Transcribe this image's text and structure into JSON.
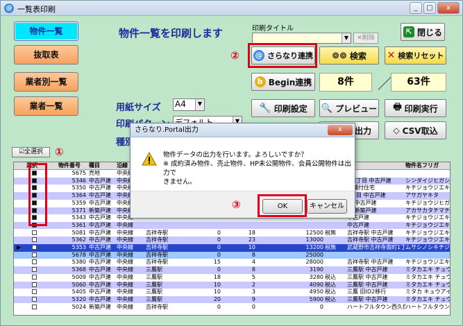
{
  "window": {
    "title": "一覧表印刷",
    "min": "_",
    "max": "□",
    "close": "x"
  },
  "nav": {
    "list": "物件一覧",
    "extract": "抜取表",
    "by_dealer": "業者別一覧",
    "dealer_list": "業者一覧"
  },
  "heading": "物件一覧を印刷します",
  "print_title": {
    "label": "印刷タイトル",
    "value": "",
    "delete_label": "削除"
  },
  "toolbar": {
    "close": "閉じる",
    "sarana": "さらなり連携",
    "search": "検索",
    "search_reset": "検索リセット",
    "begin": "Begin連携",
    "print_settings": "印刷設定",
    "preview": "プレビュー",
    "print_run": "印刷実行",
    "output": "出力",
    "csv_import": "CSV取込"
  },
  "counts": {
    "selected": "8件",
    "total": "63件",
    "slash": "／"
  },
  "paper": {
    "label": "用紙サイズ",
    "value": "A4"
  },
  "pattern": {
    "label": "印刷パターン",
    "value": "デフォルト"
  },
  "kind": {
    "label": "種別"
  },
  "select_all": "全選択",
  "markers": {
    "m1": "①",
    "m2": "②",
    "m3": "③"
  },
  "grid": {
    "headers": [
      "選択",
      "物件番号",
      "種目",
      "沿線",
      "",
      "",
      "",
      "",
      "",
      "",
      "",
      "物件名フリガ"
    ],
    "rows": [
      {
        "checked": true,
        "no": "5675",
        "type": "売地",
        "line": "中央線",
        "station": "",
        "a": "",
        "b": "",
        "price": "",
        "note": "",
        "addr": "",
        "kana": "",
        "style": ""
      },
      {
        "checked": true,
        "no": "5346",
        "type": "中古戸建",
        "line": "中央線",
        "station": "",
        "a": "",
        "b": "",
        "price": "",
        "note": "",
        "addr": "町3丁目 中古戸建",
        "kana": "シンダイジヒガシ",
        "style": "alt"
      },
      {
        "checked": true,
        "no": "5350",
        "type": "中古戸建",
        "line": "中央線",
        "station": "",
        "a": "",
        "b": "",
        "price": "",
        "note": "",
        "addr": "店舗付住宅",
        "kana": "キチジョウジエキ",
        "style": ""
      },
      {
        "checked": true,
        "no": "5364",
        "type": "中古戸建",
        "line": "中央線",
        "station": "",
        "a": "",
        "b": "",
        "price": "",
        "note": "",
        "addr": "3丁目 中古戸建",
        "kana": "アサガヤキタ",
        "style": "alt"
      },
      {
        "checked": true,
        "no": "5359",
        "type": "中古戸建",
        "line": "中央線",
        "station": "",
        "a": "",
        "b": "",
        "price": "",
        "note": "",
        "addr": "町 中古戸建",
        "kana": "キチジョウジヒガシ",
        "style": ""
      },
      {
        "checked": true,
        "no": "5371",
        "type": "新築戸建",
        "line": "中央線",
        "station": "",
        "a": "",
        "b": "",
        "price": "",
        "note": "",
        "addr": "中 新築戸建",
        "kana": "アカサカタチマチ",
        "style": "alt"
      },
      {
        "checked": true,
        "no": "5343",
        "type": "中古戸建",
        "line": "中央線",
        "station": "",
        "a": "",
        "b": "",
        "price": "",
        "note": "",
        "addr": "中古戸建",
        "kana": "キチジョウジエキ",
        "style": ""
      },
      {
        "checked": true,
        "no": "5361",
        "type": "中古戸建",
        "line": "中央線",
        "station": "",
        "a": "",
        "b": "",
        "price": "",
        "note": "",
        "addr": "中古戸建",
        "kana": "キチジョウジエキ",
        "style": "alt"
      },
      {
        "checked": false,
        "no": "5081",
        "type": "中古戸建",
        "line": "中央線",
        "station": "吉祥寺駅",
        "a": "0",
        "b": "18",
        "price": "12500",
        "note": "税無",
        "addr": "吉祥寺駅 中古戸建",
        "kana": "キチジョウジエキ",
        "style": ""
      },
      {
        "checked": false,
        "no": "5362",
        "type": "中古戸建",
        "line": "中央線",
        "station": "吉祥寺駅",
        "a": "0",
        "b": "23",
        "price": "13000",
        "note": "",
        "addr": "吉祥寺駅 中古戸建",
        "kana": "キチジョウジエキ",
        "style": "alt"
      },
      {
        "checked": false,
        "no": "5353",
        "type": "中古戸建",
        "line": "中央線",
        "station": "吉祥寺駅",
        "a": "0",
        "b": "10",
        "price": "13200",
        "note": "税無",
        "addr": "武蔵野市吉祥寺南町1丁目",
        "kana": "ムサシノシキチジ",
        "style": "sel"
      },
      {
        "checked": false,
        "no": "5678",
        "type": "中古戸建",
        "line": "中央線",
        "station": "吉祥寺駅",
        "a": "0",
        "b": "8",
        "price": "25000",
        "note": "",
        "addr": "",
        "kana": "",
        "style": "blueband"
      },
      {
        "checked": false,
        "no": "5380",
        "type": "中古戸建",
        "line": "中央線",
        "station": "吉祥寺駅",
        "a": "15",
        "b": "4",
        "price": "28000",
        "note": "",
        "addr": "吉祥寺駅 中古戸建",
        "kana": "キチジョウジエキ",
        "style": ""
      },
      {
        "checked": false,
        "no": "5368",
        "type": "中古戸建",
        "line": "中央線",
        "station": "三鷹駅",
        "a": "0",
        "b": "8",
        "price": "3190",
        "note": "",
        "addr": "三鷹駅 中古戸建",
        "kana": "ミタカエキ チュウコ",
        "style": "alt"
      },
      {
        "checked": false,
        "no": "5009",
        "type": "中古戸建",
        "line": "中央線",
        "station": "三鷹駅",
        "a": "18",
        "b": "5",
        "price": "3280",
        "note": "税込",
        "addr": "三鷹駅 中古戸建",
        "kana": "ミタカエキ チュウコ",
        "style": ""
      },
      {
        "checked": false,
        "no": "5060",
        "type": "中古戸建",
        "line": "中央線",
        "station": "三鷹駅",
        "a": "10",
        "b": "2",
        "price": "4090",
        "note": "税込",
        "addr": "三鷹駅 中古戸建",
        "kana": "ミタカエキ チュウコ",
        "style": "alt"
      },
      {
        "checked": false,
        "no": "5405",
        "type": "中古戸建",
        "line": "中央線",
        "station": "三鷹駅",
        "a": "10",
        "b": "3",
        "price": "4950",
        "note": "税込",
        "addr": "三鷹 旧ID2移行",
        "kana": "ミタカ キュウアイ",
        "style": ""
      },
      {
        "checked": false,
        "no": "5320",
        "type": "中古戸建",
        "line": "中央線",
        "station": "三鷹駅",
        "a": "20",
        "b": "9",
        "price": "5900",
        "note": "税込",
        "addr": "三鷹駅 中古戸建",
        "kana": "ミタカエキ チュウコ",
        "style": "alt"
      },
      {
        "checked": false,
        "no": "5024",
        "type": "新築戸建",
        "line": "中央線",
        "station": "吉祥寺駅",
        "a": "0",
        "b": "0",
        "price": "0",
        "note": "",
        "addr": "ハートフルタウン西久保の郷",
        "kana": "ハートフルタウン",
        "style": ""
      }
    ]
  },
  "dialog": {
    "title": "さらなり.Portal出力",
    "close": "x",
    "line1": "物件データの出力を行います。よろしいですか？",
    "line2": "※ 成約済み物件、売止物件、HP未公開物件、会員公開物件は出力で",
    "line3": "きません。",
    "ok": "OK",
    "cancel": "キャンセル"
  },
  "colors": {
    "accent_red": "#e0001a",
    "bg_green": "#bfe6c8",
    "heading_blue": "#1f2a9a"
  }
}
